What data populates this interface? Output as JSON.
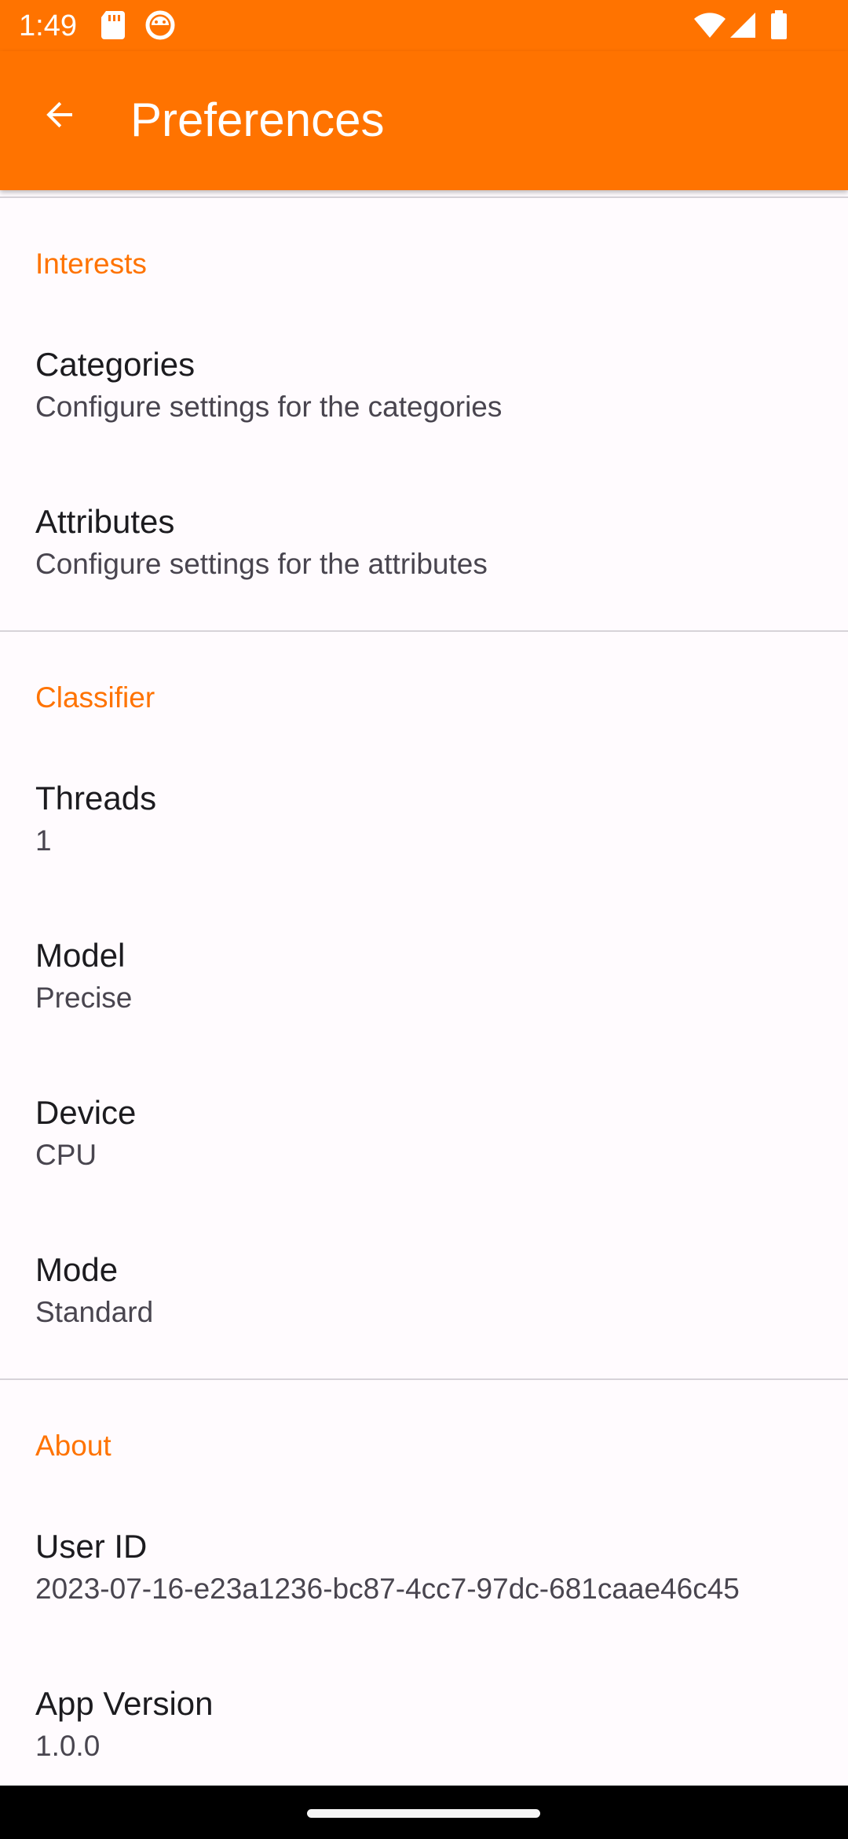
{
  "status_bar": {
    "time": "1:49"
  },
  "app_bar": {
    "title": "Preferences",
    "back_icon": "arrow-back-icon"
  },
  "colors": {
    "accent": "#ff7300",
    "background": "#fffbfe"
  },
  "sections": {
    "interests": {
      "title": "Interests",
      "categories": {
        "title": "Categories",
        "summary": "Configure settings for the categories"
      },
      "attributes": {
        "title": "Attributes",
        "summary": "Configure settings for the attributes"
      }
    },
    "classifier": {
      "title": "Classifier",
      "threads": {
        "title": "Threads",
        "summary": "1"
      },
      "model": {
        "title": "Model",
        "summary": "Precise"
      },
      "device": {
        "title": "Device",
        "summary": "CPU"
      },
      "mode": {
        "title": "Mode",
        "summary": "Standard"
      }
    },
    "about": {
      "title": "About",
      "user_id": {
        "title": "User ID",
        "summary": "2023-07-16-e23a1236-bc87-4cc7-97dc-681caae46c45"
      },
      "app_version": {
        "title": "App Version",
        "summary": "1.0.0"
      }
    }
  }
}
